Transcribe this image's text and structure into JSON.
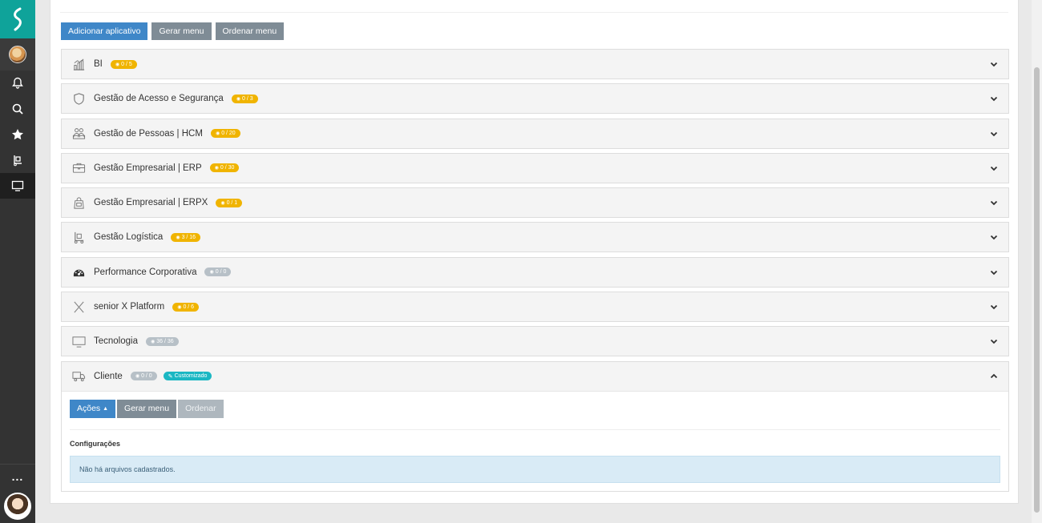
{
  "toolbar": {
    "add_app": "Adicionar aplicativo",
    "gen_menu": "Gerar menu",
    "sort_menu": "Ordenar menu"
  },
  "groups": [
    {
      "name": "BI",
      "badge": "0 / 5",
      "icon": "chart-bars-icon",
      "badge_color": "yellow"
    },
    {
      "name": "Gestão de Acesso e Segurança",
      "badge": "0 / 3",
      "icon": "shield-icon",
      "badge_color": "yellow"
    },
    {
      "name": "Gestão de Pessoas | HCM",
      "badge": "0 / 20",
      "icon": "people-icon",
      "badge_color": "yellow"
    },
    {
      "name": "Gestão Empresarial | ERP",
      "badge": "0 / 30",
      "icon": "briefcase-icon",
      "badge_color": "yellow"
    },
    {
      "name": "Gestão Empresarial | ERPX",
      "badge": "0 / 1",
      "icon": "bag-icon",
      "badge_color": "yellow"
    },
    {
      "name": "Gestão Logística",
      "badge": "3 / 16",
      "icon": "dolly-icon",
      "badge_color": "yellow"
    },
    {
      "name": "Performance Corporativa",
      "badge": "0 / 0",
      "icon": "dashboard-icon",
      "badge_color": "gray"
    },
    {
      "name": "senior X Platform",
      "badge": "0 / 6",
      "icon": "x-icon",
      "badge_color": "yellow"
    },
    {
      "name": "Tecnologia",
      "badge": "36 / 36",
      "icon": "monitor-icon",
      "badge_color": "gray"
    }
  ],
  "client_group": {
    "name": "Cliente",
    "badge": "0 / 0",
    "custom_badge": "Customizado",
    "actions_label": "Ações",
    "gen_menu": "Gerar menu",
    "sort": "Ordenar",
    "section_title": "Configurações",
    "empty_message": "Não há arquivos cadastrados."
  },
  "sidebar": {
    "more_label": "..."
  },
  "colors": {
    "brand_teal": "#0fa39a",
    "primary_blue": "#3f87c8",
    "badge_yellow": "#f0b400",
    "badge_teal": "#1bb7c3"
  }
}
